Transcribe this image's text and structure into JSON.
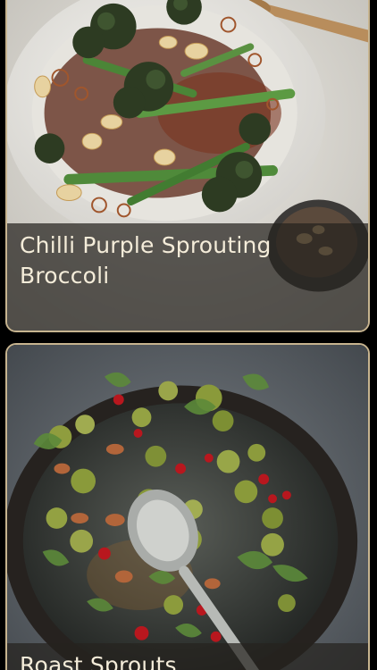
{
  "recipes": [
    {
      "title": "Chilli Purple Sprouting Broccoli"
    },
    {
      "title": "Roast Sprouts"
    }
  ],
  "colors": {
    "background": "#000000",
    "card_border": "#c7b48f",
    "caption_text": "#f4ecd9"
  }
}
